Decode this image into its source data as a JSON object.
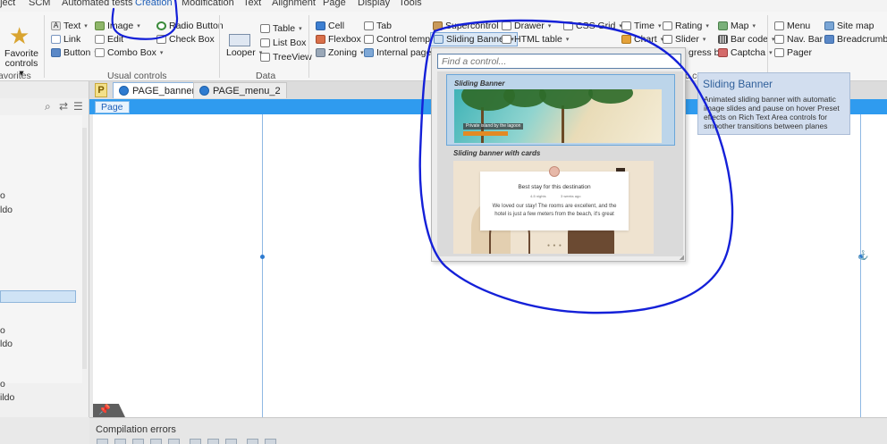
{
  "menubar": {
    "items": [
      "oject",
      "SCM",
      "Automated tests",
      "Creation",
      "Modification",
      "Text",
      "Alignment",
      "Page",
      "Display",
      "Tools"
    ],
    "active_index": 3
  },
  "ribbon": {
    "favorites": {
      "label": "Favorite controls",
      "group_label": "avorites"
    },
    "usual": {
      "text": "Text",
      "link": "Link",
      "button": "Button",
      "image": "Image",
      "edit": "Edit",
      "combo_box": "Combo Box",
      "radio_button": "Radio Button",
      "check_box": "Check Box",
      "group_label": "Usual controls"
    },
    "data": {
      "looper": "Looper",
      "table": "Table",
      "list_box": "List Box",
      "treeview": "TreeView",
      "group_label": "Data"
    },
    "layout": {
      "cell": "Cell",
      "flexbox": "Flexbox",
      "zoning": "Zoning",
      "tab": "Tab",
      "control_template": "Control template",
      "internal_page": "Internal page"
    },
    "special": {
      "supercontrol": "Supercontrol",
      "drawer": "Drawer",
      "sliding_banner": "Sliding Banner",
      "html_table": "HTML table",
      "css_grid": "CSS Grid",
      "time": "Time",
      "rating": "Rating",
      "chart": "Chart",
      "slider": "Slider",
      "progress_bar_partial": "gress bar",
      "group_partial": "c co"
    },
    "navigation": {
      "map": "Map",
      "bar_code": "Bar code",
      "captcha": "Captcha",
      "menu": "Menu",
      "nav_bar": "Nav. Bar",
      "pager": "Pager",
      "site_map": "Site map",
      "breadcrumb": "Breadcrumb"
    }
  },
  "left_pane": {
    "items": [
      "o",
      "ldo",
      "o",
      "ldo",
      "o",
      "ildo"
    ]
  },
  "doc_tabs": {
    "tabs": [
      {
        "label": "PAGE_banner",
        "active": true
      },
      {
        "label": "PAGE_menu_2",
        "active": false
      }
    ]
  },
  "page_tab": {
    "label": "Page"
  },
  "popup": {
    "search_placeholder": "Find a control...",
    "cards": [
      {
        "title": "Sliding Banner",
        "selected": true,
        "caption": "Private island by the lagoon"
      },
      {
        "title": "Sliding banner with cards",
        "selected": false,
        "review_title": "Best stay for this destination",
        "meta_left": "4-5 nights",
        "meta_right": "3 weeks ago",
        "review_line1": "We loved our stay! The rooms are excellent, and the",
        "review_line2": "hotel is just a few meters from the beach, it's great"
      }
    ]
  },
  "tooltip": {
    "title": "Sliding Banner",
    "body": "Animated sliding banner with automatic image slides and pause on hover Preset effects on Rich Text Area controls for smoother transitions between planes"
  },
  "bottom": {
    "compilation_errors": "Compilation errors"
  },
  "colors": {
    "accent_blue": "#2f9bef",
    "active_menu": "#1f5fb8",
    "annotation_ink": "#1420d8",
    "tooltip_bg": "#d2deef"
  }
}
